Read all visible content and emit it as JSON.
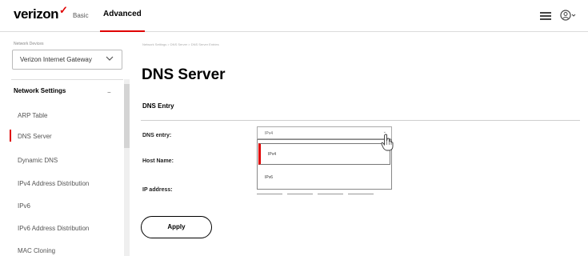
{
  "header": {
    "logo_text": "verizon",
    "logo_mark": "✓",
    "nav_basic": "Basic",
    "nav_advanced": "Advanced",
    "menu_icon": "menu-icon",
    "user_icon": "user-icon"
  },
  "sidebar": {
    "device_label": "Network Devices",
    "device_select_value": "Verizon Internet Gateway",
    "section_title": "Network Settings",
    "section_toggle": "−",
    "items": [
      {
        "label": "ARP Table"
      },
      {
        "label": "DNS Server",
        "active": true
      },
      {
        "label": "Dynamic DNS"
      },
      {
        "label": "IPv4 Address Distribution"
      },
      {
        "label": "IPv6"
      },
      {
        "label": "IPv6 Address Distribution"
      },
      {
        "label": "MAC Cloning"
      }
    ]
  },
  "main": {
    "breadcrumb": "Network Settings > DNS Server > DNS Server Entries",
    "page_title": "DNS Server",
    "section_heading": "DNS Entry",
    "labels": {
      "dns_entry": "DNS entry:",
      "host_name": "Host Name:",
      "ip_address": "IP address:"
    },
    "dns_entry_select": {
      "value": "IPv4",
      "options": [
        "IPv4",
        "IPv6"
      ],
      "highlighted": "IPv4"
    },
    "apply_label": "Apply"
  },
  "colors": {
    "accent": "#e00000",
    "border": "#aaaaaa"
  }
}
